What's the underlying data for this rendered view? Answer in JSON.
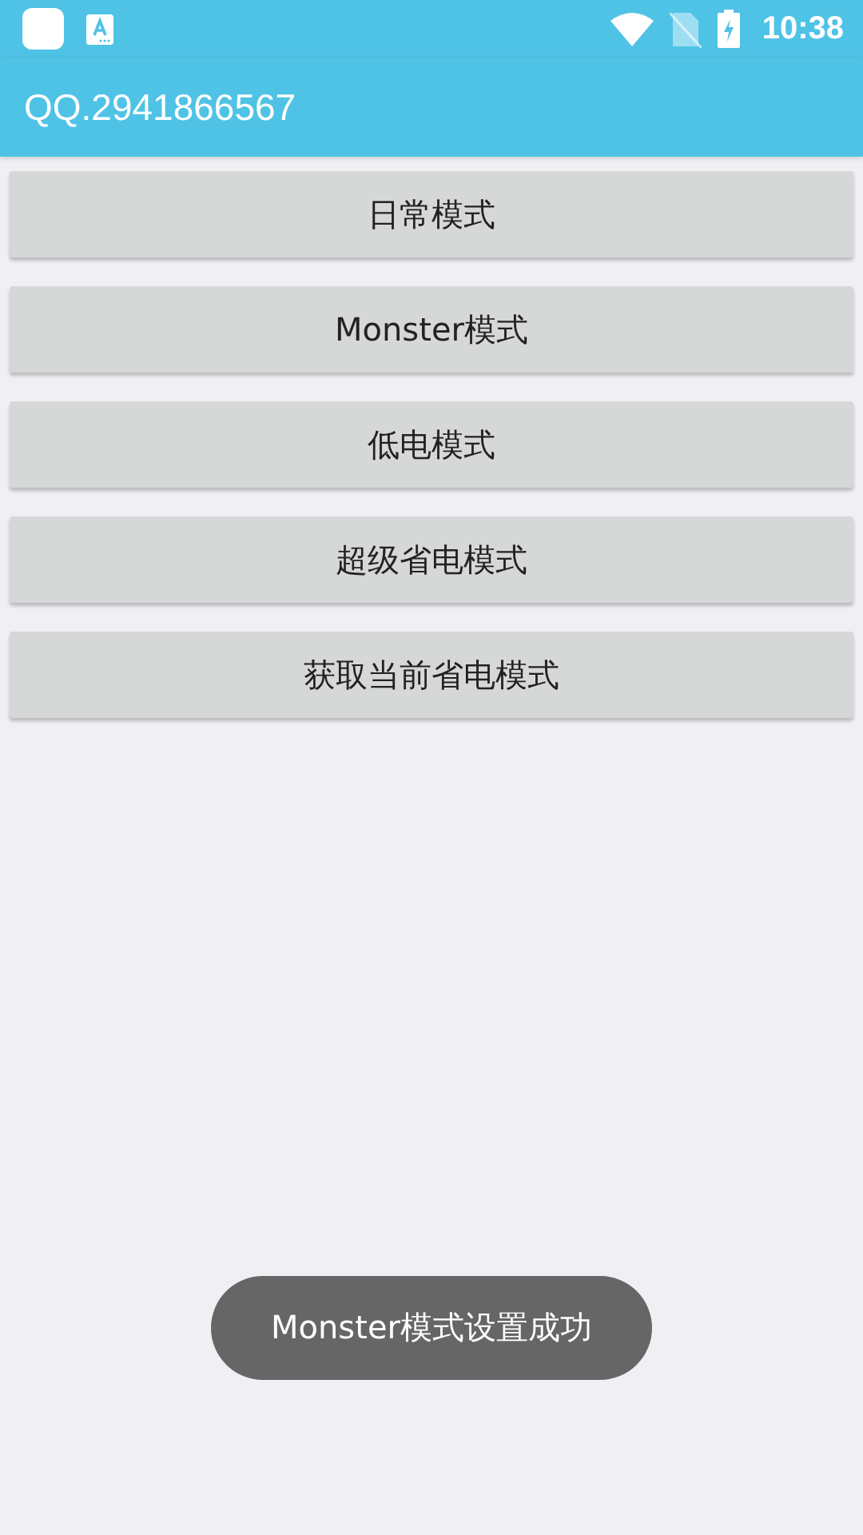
{
  "status_bar": {
    "time": "10:38"
  },
  "app_bar": {
    "title": "QQ.2941866567"
  },
  "buttons": [
    {
      "label": "日常模式"
    },
    {
      "label": "Monster模式"
    },
    {
      "label": "低电模式"
    },
    {
      "label": "超级省电模式"
    },
    {
      "label": "获取当前省电模式"
    }
  ],
  "toast": {
    "text": "Monster模式设置成功"
  }
}
